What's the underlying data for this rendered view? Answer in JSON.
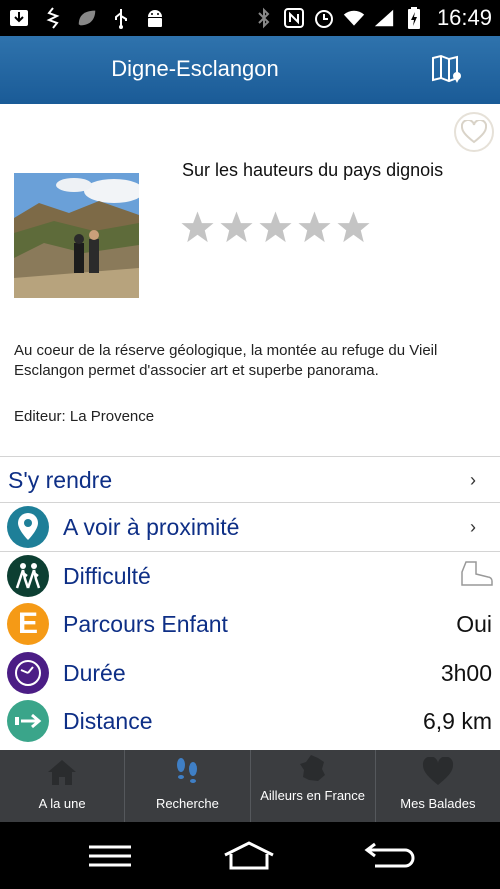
{
  "status_bar": {
    "time": "16:49",
    "icons": [
      "download-icon",
      "usb-debug-icon",
      "leaf-icon",
      "usb-icon",
      "android-icon",
      "bluetooth-icon",
      "nfc-icon",
      "alarm-icon",
      "wifi-icon",
      "signal-icon",
      "battery-icon"
    ]
  },
  "header": {
    "title": "Digne-Esclangon",
    "map_icon": "map-icon"
  },
  "hike": {
    "title": "Sur les hauteurs du pays dignois",
    "rating": 0,
    "rating_max": 5,
    "description": "Au coeur de la réserve géologique, la montée au refuge du Vieil Esclangon permet d'associer art et superbe panorama.",
    "editor_label": "Editeur:",
    "editor_name": "La Provence"
  },
  "rows": [
    {
      "label": "S'y rendre",
      "value": "",
      "chevron": "›",
      "icon": ""
    },
    {
      "label": "A voir à proximité",
      "value": "",
      "chevron": "›",
      "icon": "location-pin-icon",
      "icon_color": "#1e7f98"
    },
    {
      "label": "Difficulté",
      "value": "",
      "chevron": "",
      "icon": "hikers-icon",
      "icon_color": "#0d3f32"
    },
    {
      "label": "Parcours Enfant",
      "value": "Oui",
      "chevron": "",
      "icon": "letter-e-icon",
      "icon_letter": "E",
      "icon_color": "#f59a16"
    },
    {
      "label": "Durée",
      "value": "3h00",
      "chevron": "",
      "icon": "clock-icon",
      "icon_color": "#4b1d85"
    },
    {
      "label": "Distance",
      "value": "6,9  km",
      "chevron": "",
      "icon": "distance-arrow-icon",
      "icon_color": "#3aa58a"
    }
  ],
  "tabs": [
    {
      "label": "A la une",
      "icon": "home-icon"
    },
    {
      "label": "Recherche",
      "icon": "footprints-icon"
    },
    {
      "label": "Ailleurs en France",
      "icon": "france-map-icon"
    },
    {
      "label": "Mes Balades",
      "icon": "heart-icon"
    }
  ],
  "colors": {
    "header": "#1f63a0",
    "label_blue": "#0e2f86",
    "tabbar": "#3b3d40",
    "active_tab_icon": "#3f7fc5"
  }
}
